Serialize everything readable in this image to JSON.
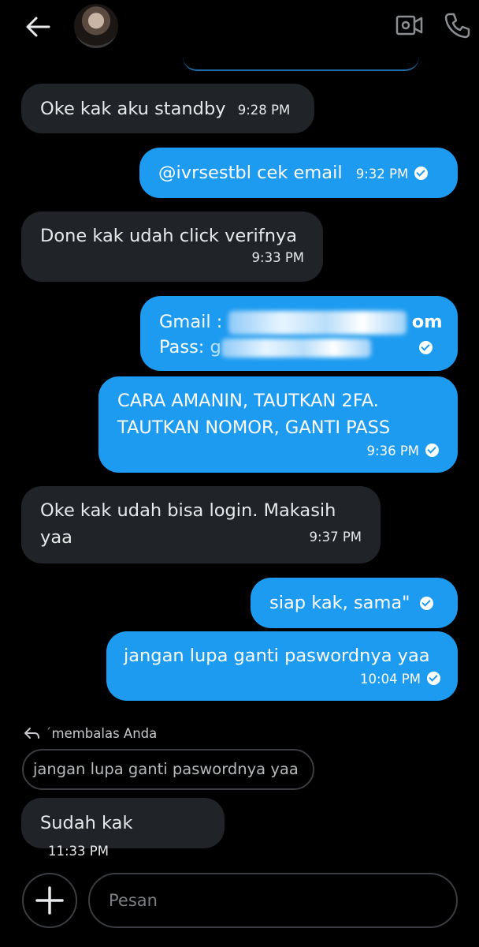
{
  "header": {
    "back_icon": "arrow-left-icon",
    "avatar": "contact-avatar",
    "video_icon": "video-call-icon",
    "phone_icon": "phone-icon"
  },
  "messages": [
    {
      "direction": "in",
      "text": "Oke kak aku standby",
      "time": "9:28 PM"
    },
    {
      "direction": "out",
      "mention": "@ivrsestbl",
      "text": "cek email",
      "time": "9:32 PM",
      "status": "read"
    },
    {
      "direction": "in",
      "text": "Done kak udah click verifnya",
      "time": "9:33 PM"
    },
    {
      "direction": "out",
      "line1_label": "Gmail :",
      "line1_tail": "om",
      "line2_label": "Pass:",
      "line2_partial": "g",
      "redacted": true,
      "status": "read"
    },
    {
      "direction": "out",
      "line1": "CARA AMANIN, TAUTKAN 2FA.",
      "line2": "TAUTKAN NOMOR, GANTI PASS",
      "time": "9:36 PM",
      "status": "read"
    },
    {
      "direction": "in",
      "line1": "Oke kak udah bisa login. Makasih",
      "line2": "yaa",
      "time": "9:37 PM"
    },
    {
      "direction": "out",
      "text": "siap kak, sama\"",
      "status": "read"
    },
    {
      "direction": "out",
      "text": "jangan lupa ganti paswordnya yaa",
      "time": "10:04 PM",
      "status": "read"
    }
  ],
  "reply": {
    "label": "membalas Anda",
    "quoted": "jangan lupa ganti paswordnya yaa",
    "text": "Sudah kak",
    "time": "11:33 PM"
  },
  "composer": {
    "placeholder": "Pesan",
    "add_icon": "plus-icon"
  }
}
